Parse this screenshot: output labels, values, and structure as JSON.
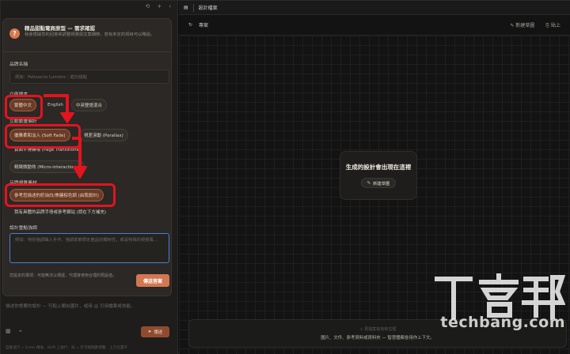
{
  "left_panel": {
    "toolbar_icons": [
      "history-icon",
      "plus-icon",
      "collapse-icon"
    ],
    "card": {
      "title": "精品甜點電商原型 — 需求確認",
      "subtitle": "我會根據您的回答來調整視覺與文案細節，若有未定的項目可以略過。"
    },
    "brand_name": {
      "label": "品牌名稱",
      "placeholder": "例如：Patisserie Lumière｜甜光甜點"
    },
    "language": {
      "label": "介面語言",
      "options": [
        "繁體中文",
        "English",
        "中英雙語混合"
      ],
      "selected": "繁體中文"
    },
    "animation": {
      "label": "互動動畫偏好",
      "options": [
        "優雅柔和淡入 (Soft Fade)",
        "視差滾動 (Parallax)",
        "頁面平滑轉場 (Page Transitions)",
        "精緻微動效 (Micro-interactions)"
      ],
      "selected": "優雅柔和淡入 (Soft Fade)"
    },
    "imagery": {
      "label": "品牌視覺素材",
      "options": [
        "參考您描述的奶油白/焦糖棕色調 (由我設計)",
        "我有具體的品牌手冊或參考網站 (請在下方補充)"
      ],
      "selected": "參考您描述的奶油白/焦糖棕色調 (由我設計)"
    },
    "notes": {
      "label": "設計重點強調",
      "placeholder": "例如：特別強調職人手作、強調季節限定產品的獨特性，或是特殊的視覺風..."
    },
    "footer_note": "您設定的選項：可能無法以傳遞，代理會使用合理的預設值。",
    "submit_label": "傳送答案",
    "chat_placeholder": "描述你想要的設計 — 可貼上類似圖片，或用 @ 引用檔案或技能。",
    "chat_tool_icons": [
      "grid-icon",
      "attach-icon"
    ],
    "send_label": "傳送",
    "bottom_text": "自動進行 + Enter 傳送．Shift 上換行．按 = 於可縮閱數預覽．上方位置不"
  },
  "right_panel": {
    "tab_label": "設計檔案",
    "toolbar": {
      "refresh_icon": "refresh-icon",
      "project_label": "專案",
      "new_draft_label": "新建草圖",
      "paste_label": "貼上"
    },
    "placeholder_title": "生成的設計會出現在這裡",
    "placeholder_button": "新建草圖",
    "drop_zone": {
      "line1": "＋ 把檔案拖曳到這裡",
      "line2": "圖片、文件、參考資料或資料夾 — 智慧體都會用作上下文。"
    }
  },
  "watermark": {
    "brand_cjk": "T客邦",
    "site": "techbang.com"
  },
  "colors": {
    "accent": "#d27751",
    "selected_chip": "#6a3c27",
    "annotation_red": "#e3141e",
    "focus_blue": "#4c7cd8"
  }
}
